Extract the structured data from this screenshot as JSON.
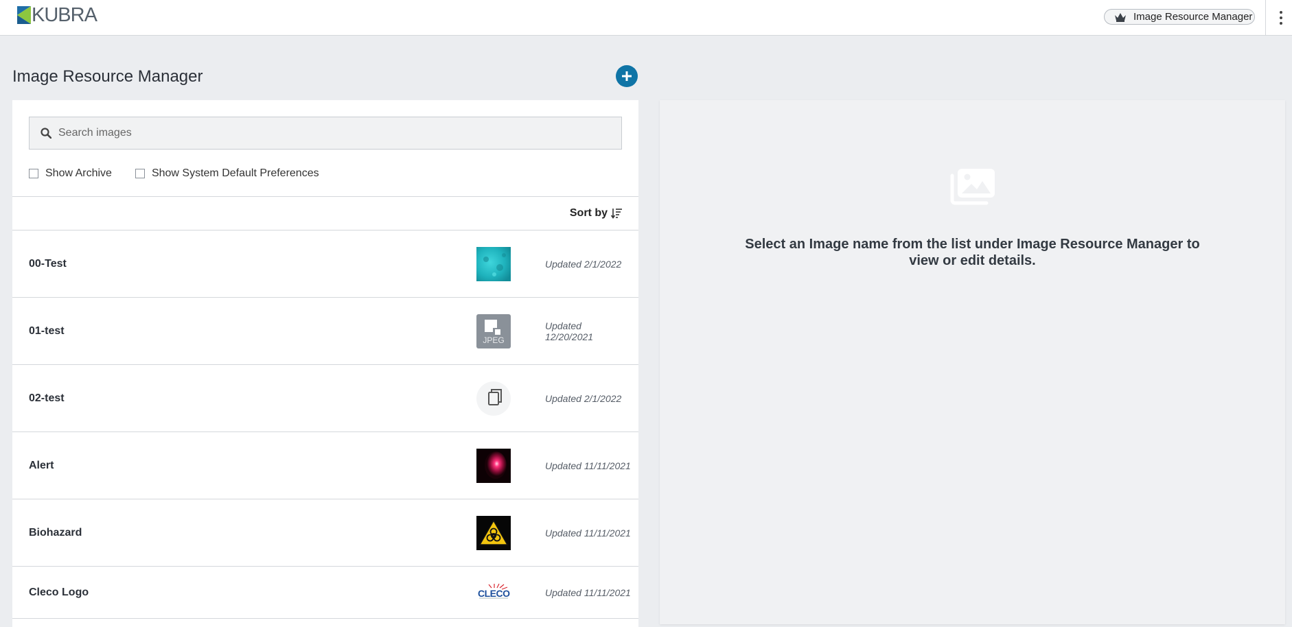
{
  "header": {
    "logo_text": "KUBRA",
    "app_switcher_label": "Image Resource Manager",
    "colors": {
      "logo_green": "#8dc63f",
      "logo_blue": "#1f6ea7",
      "accent": "#0f74a6"
    }
  },
  "page": {
    "title": "Image Resource Manager",
    "add_icon": "plus-icon"
  },
  "search": {
    "placeholder": "Search images",
    "value": ""
  },
  "filters": {
    "show_archive": {
      "label": "Show Archive",
      "checked": false
    },
    "show_system_defaults": {
      "label": "Show System Default Preferences",
      "checked": false
    }
  },
  "sort": {
    "label": "Sort by",
    "icon": "sort-descending-icon"
  },
  "images": [
    {
      "name": "00-Test",
      "updated": "Updated 2/1/2022",
      "thumb": "teal-texture"
    },
    {
      "name": "01-test",
      "updated": "Updated 12/20/2021",
      "thumb": "jpeg-placeholder",
      "thumb_text": "JPEG"
    },
    {
      "name": "02-test",
      "updated": "Updated 2/1/2022",
      "thumb": "copy-icon"
    },
    {
      "name": "Alert",
      "updated": "Updated 11/11/2021",
      "thumb": "red-glow"
    },
    {
      "name": "Biohazard",
      "updated": "Updated 11/11/2021",
      "thumb": "biohazard-sign"
    },
    {
      "name": "Cleco Logo",
      "updated": "Updated 11/11/2021",
      "thumb": "cleco-logo",
      "thumb_text": "CLECO"
    }
  ],
  "detail": {
    "empty_icon": "image-gallery-icon",
    "empty_message": "Select an Image name from the list under Image Resource Manager to view or edit details."
  }
}
